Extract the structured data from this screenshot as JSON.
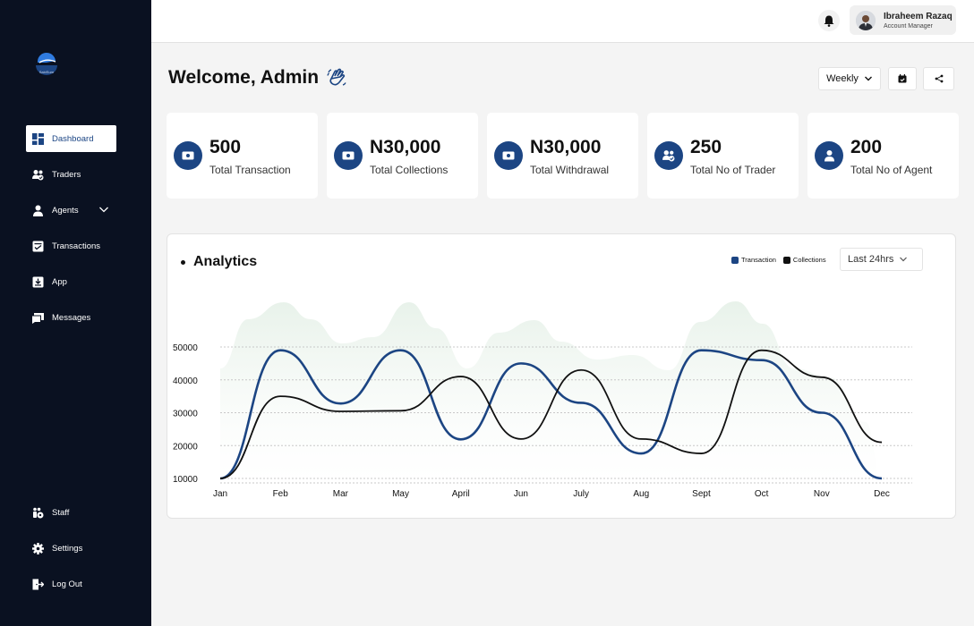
{
  "brand": {
    "name": "SabiSure"
  },
  "sidebar": {
    "items": [
      {
        "label": "Dashboard",
        "icon": "dashboard-icon"
      },
      {
        "label": "Traders",
        "icon": "traders-icon"
      },
      {
        "label": "Agents",
        "icon": "agents-icon"
      },
      {
        "label": "Transactions",
        "icon": "transactions-icon"
      },
      {
        "label": "App",
        "icon": "app-download-icon"
      },
      {
        "label": "Messages",
        "icon": "messages-icon"
      }
    ],
    "bottom_items": [
      {
        "label": "Staff",
        "icon": "staff-icon"
      },
      {
        "label": "Settings",
        "icon": "gear-icon"
      },
      {
        "label": "Log Out",
        "icon": "logout-icon"
      }
    ]
  },
  "topbar": {
    "user_name": "Ibraheem Razaq",
    "user_role": "Account Manager"
  },
  "header": {
    "title": "Welcome, Admin",
    "period": "Weekly"
  },
  "stats": [
    {
      "value": "500",
      "label": "Total Transaction"
    },
    {
      "value": "N30,000",
      "label": "Total Collections"
    },
    {
      "value": "N30,000",
      "label": "Total Withdrawal"
    },
    {
      "value": "250",
      "label": "Total No of Trader"
    },
    {
      "value": "200",
      "label": "Total No of Agent"
    }
  ],
  "analytics": {
    "title": "Analytics",
    "range": "Last 24hrs"
  },
  "colors": {
    "sidebar": "#0a1121",
    "accent": "#1c4583",
    "collections": "#111111",
    "area": "#e8f2ea"
  },
  "chart_data": {
    "type": "line",
    "categories": [
      "Jan",
      "Feb",
      "Mar",
      "May",
      "April",
      "Jun",
      "July",
      "Aug",
      "Sept",
      "Oct",
      "Nov",
      "Dec"
    ],
    "y_ticks": [
      50000,
      40000,
      30000,
      20000,
      10000
    ],
    "ylim": [
      10000,
      50000
    ],
    "grid": "horizontal-dotted",
    "legend": "top-right",
    "series": [
      {
        "name": "Transaction",
        "color": "#1c4583",
        "values": [
          10000,
          49000,
          32800,
          49000,
          21900,
          45000,
          33000,
          17600,
          49000,
          46000,
          30000,
          10000
        ]
      },
      {
        "name": "Collections",
        "color": "#111111",
        "values": [
          10000,
          35000,
          30400,
          30600,
          41000,
          22000,
          43000,
          22000,
          17600,
          49000,
          40800,
          21000
        ]
      }
    ]
  }
}
